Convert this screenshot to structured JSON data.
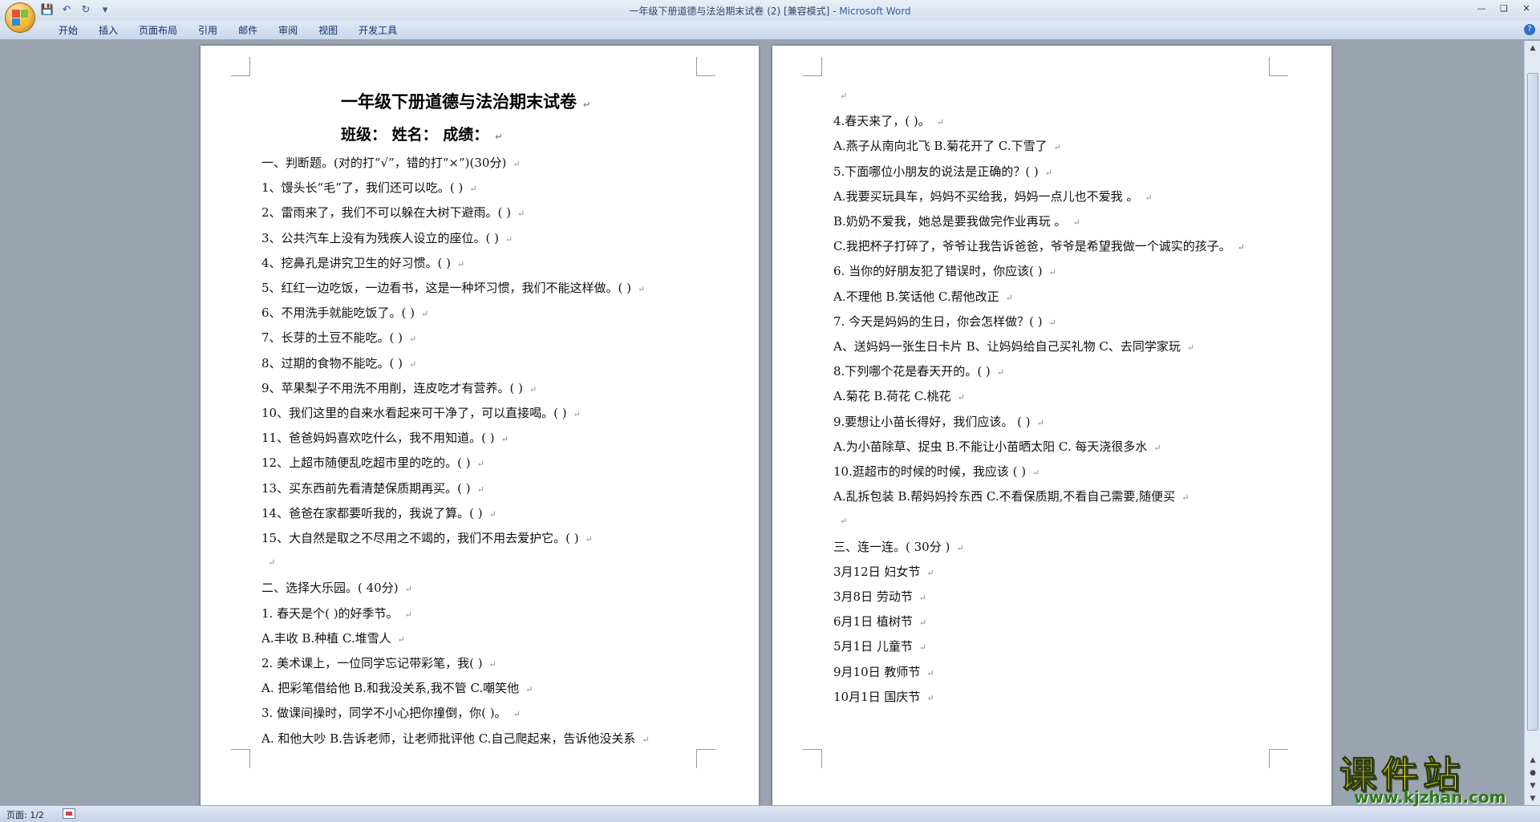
{
  "window": {
    "title_doc": "一年级下册道德与法治期末试卷 (2) [兼容模式] - ",
    "title_app": "Microsoft Word"
  },
  "ribbon": {
    "tabs": [
      "开始",
      "插入",
      "页面布局",
      "引用",
      "邮件",
      "审阅",
      "视图",
      "开发工具"
    ]
  },
  "page1": {
    "title": "一年级下册道德与法治期末试卷",
    "subtitle": "班级：           姓名：           成绩：",
    "lines": [
      "一、判断题。(对的打“√”，错的打“×”)(30分)",
      "1、馒头长“毛”了，我们还可以吃。(        )",
      "2、雷雨来了，我们不可以躲在大树下避雨。(        )",
      "3、公共汽车上没有为残疾人设立的座位。(        )",
      "4、挖鼻孔是讲究卫生的好习惯。(        )",
      "5、红红一边吃饭，一边看书，这是一种坏习惯，我们不能这样做。(        )",
      "6、不用洗手就能吃饭了。(        )",
      "7、长芽的土豆不能吃。(        )",
      "8、过期的食物不能吃。(        )",
      "9、苹果梨子不用洗不用削，连皮吃才有营养。(        )",
      "10、我们这里的自来水看起来可干净了，可以直接喝。(        )",
      "11、爸爸妈妈喜欢吃什么，我不用知道。(        )",
      "12、上超市随便乱吃超市里的吃的。(        )",
      "13、买东西前先看清楚保质期再买。(        )",
      "14、爸爸在家都要听我的，我说了算。(        )",
      "15、大自然是取之不尽用之不竭的，我们不用去爱护它。(        )",
      "",
      "二、选择大乐园。( 40分)",
      "1.   春天是个(     )的好季节。",
      "  A.丰收          B.种植          C.堆雪人",
      "2. 美术课上，一位同学忘记带彩笔，我(     )",
      "A. 把彩笔借给他          B.和我没关系,我不管          C.嘲笑他",
      "3. 做课间操时，同学不小心把你撞倒，你(     )。",
      "A. 和他大吵     B.告诉老师，让老师批评他   C.自己爬起来，告诉他没关系"
    ]
  },
  "page2": {
    "lines": [
      "",
      "4.春天来了，(     )。",
      "A.燕子从南向北飞               B.菊花开了            C.下雪了",
      "5.下面哪位小朋友的说法是正确的？(      )",
      "A.我要买玩具车，妈妈不买给我，妈妈一点儿也不爱我   。",
      "B.奶奶不爱我，她总是要我做完作业再玩   。",
      "C.我把杯子打碎了，爷爷让我告诉爸爸，爷爷是希望我做一个诚实的孩子。",
      "6.   当你的好朋友犯了错误时，你应该(     )",
      "A.不理他          B.笑话他               C.帮他改正",
      "7. 今天是妈妈的生日，你会怎样做？(      )",
      "A、送妈妈一张生日卡片   B、让妈妈给自己买礼物   C、去同学家玩",
      "8.下列哪个花是春天开的。(      )",
      "A.菊花               B.荷花          C.桃花",
      "9.要想让小苗长得好，我们应该。   (     )",
      "A.为小苗除草、捉虫     B.不能让小苗晒太阳      C.   每天浇很多水",
      "10.逛超市的时候的时候，我应该   (      )",
      "A.乱拆包装          B.帮妈妈拎东西        C.不看保质期,不看自己需要,随便买",
      "",
      "三、连一连。(   30分   )",
      "3月12日                         妇女节",
      "3月8日                            劳动节",
      "6月1日                          植树节",
      "5月1日                          儿童节",
      "9月10日                           教师节",
      "10月1日                         国庆节"
    ]
  },
  "statusbar": {
    "page_label": "页面: 1/2"
  },
  "watermark": {
    "title": "课件站",
    "url": "www.kjzhan.com"
  },
  "colors": {
    "title_app": "#2f5fa8",
    "ribbon_tab_text": "#15306a",
    "watermark_yellow": "#f5e11a",
    "watermark_green": "#2f7a1a"
  }
}
